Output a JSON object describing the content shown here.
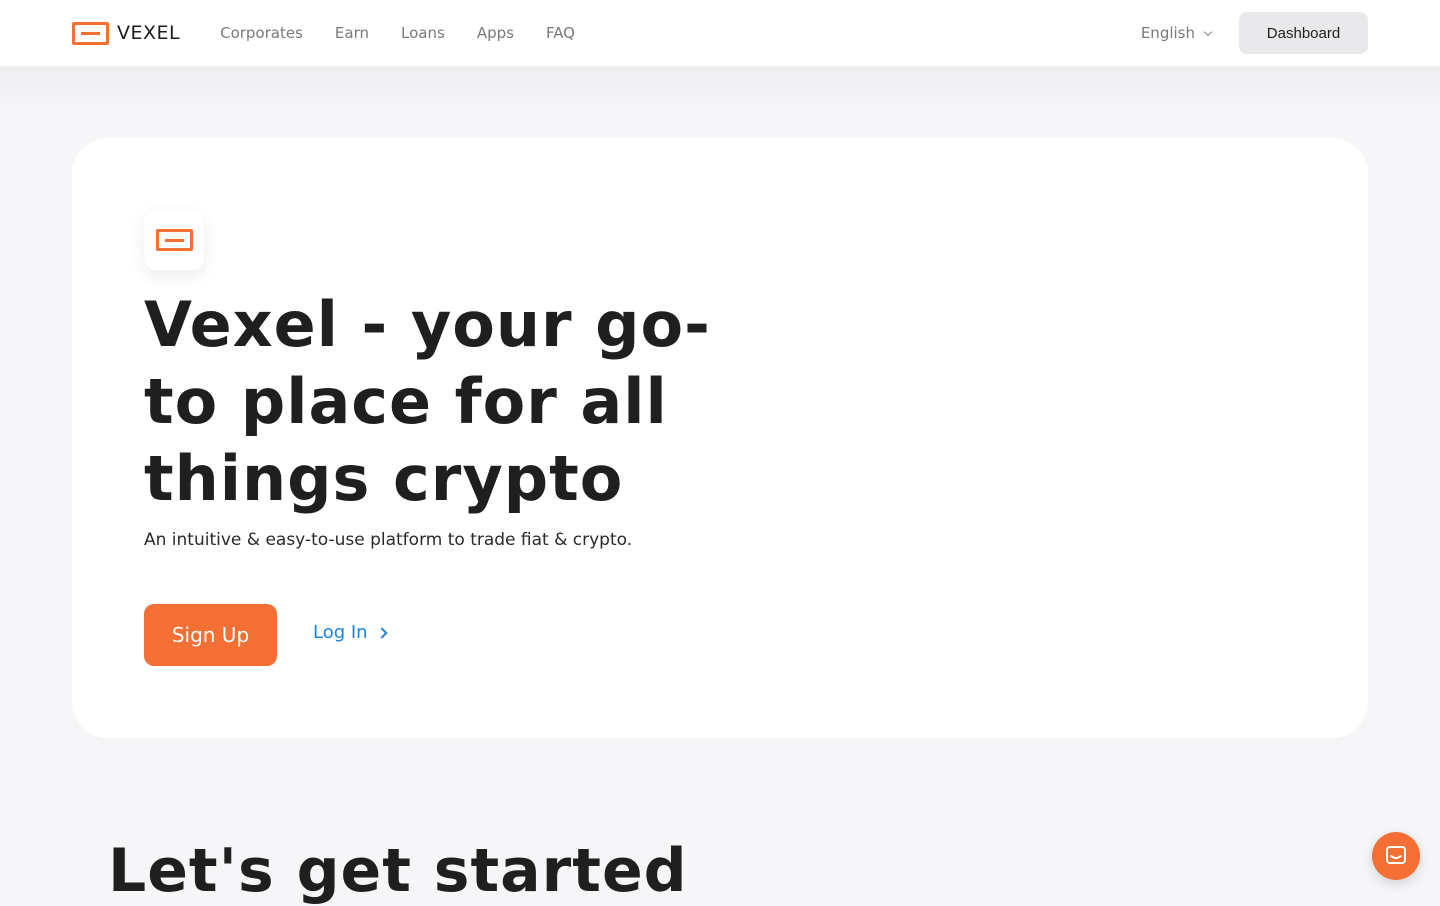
{
  "header": {
    "brand": "VEXEL",
    "nav": [
      "Corporates",
      "Earn",
      "Loans",
      "Apps",
      "FAQ"
    ],
    "language": "English",
    "dashboard_label": "Dashboard"
  },
  "hero": {
    "title": "Vexel - your go-to place for all things crypto",
    "subtitle": "An intuitive & easy-to-use platform to trade fiat & crypto.",
    "signup_label": "Sign Up",
    "login_label": "Log In"
  },
  "section": {
    "title": "Let's get started"
  },
  "colors": {
    "accent": "#f36f34",
    "link": "#1f84d6",
    "background": "#f6f6f8"
  },
  "icons": {
    "brand": "vexel-logo-icon",
    "chat": "chat-icon"
  }
}
